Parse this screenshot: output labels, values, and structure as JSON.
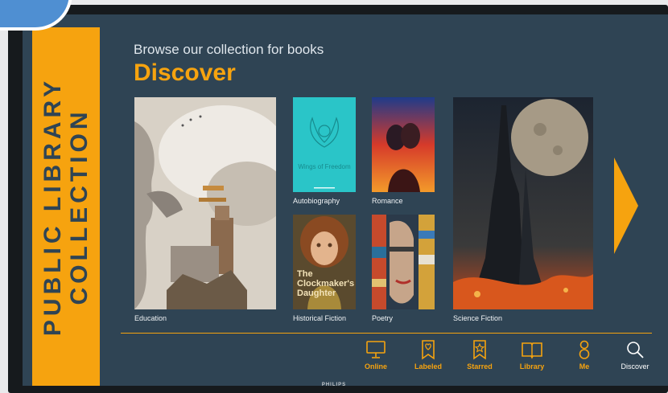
{
  "sidebar": {
    "line1": "PUBLIC LIBRARY",
    "line2": "COLLECTION"
  },
  "header": {
    "subtitle": "Browse our collection for books",
    "title": "Discover"
  },
  "books": [
    {
      "label": "Education"
    },
    {
      "label": "Autobiography",
      "cover_title": "Wings of Freedom"
    },
    {
      "label": "Romance"
    },
    {
      "label": "Historical Fiction",
      "cover_title": "The Clockmaker's Daughter"
    },
    {
      "label": "Poetry"
    },
    {
      "label": "Science Fiction"
    }
  ],
  "nav": [
    {
      "label": "Online",
      "icon": "monitor-icon"
    },
    {
      "label": "Labeled",
      "icon": "bookmark-heart-icon"
    },
    {
      "label": "Starred",
      "icon": "bookmark-star-icon"
    },
    {
      "label": "Library",
      "icon": "open-book-icon"
    },
    {
      "label": "Me",
      "icon": "person-icon"
    },
    {
      "label": "Discover",
      "icon": "search-icon"
    }
  ],
  "brand": "PHILIPS",
  "colors": {
    "accent": "#f6a30f",
    "background": "#2f4454",
    "bezel": "#161a1d"
  }
}
